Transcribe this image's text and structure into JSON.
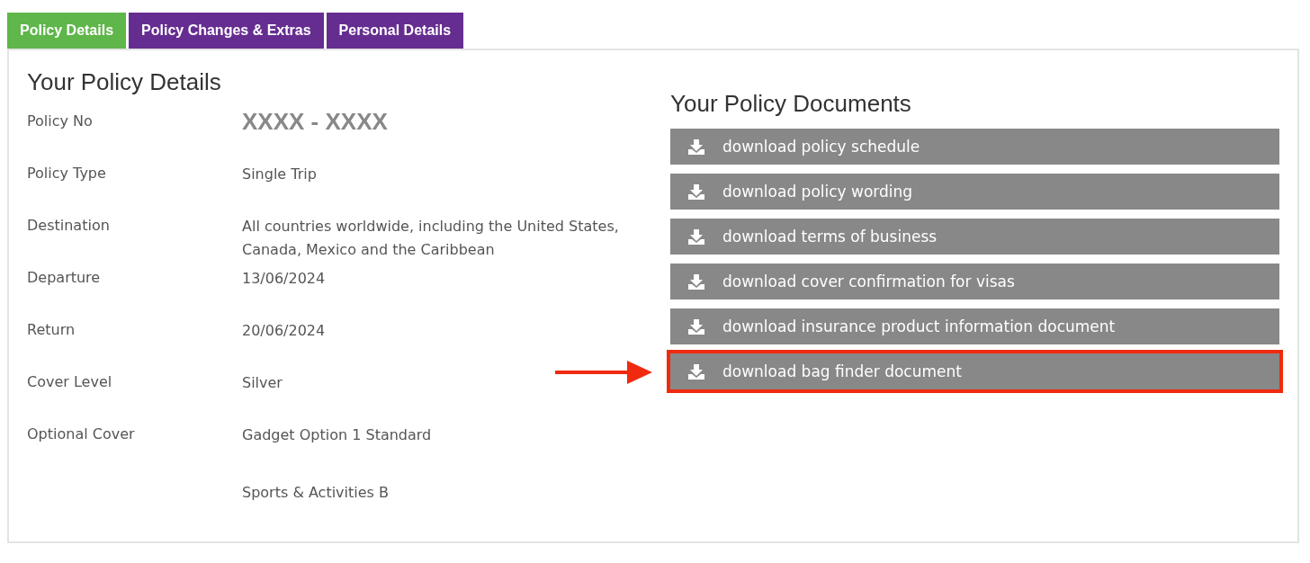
{
  "tabs": [
    {
      "label": "Policy Details",
      "selected": true
    },
    {
      "label": "Policy Changes & Extras",
      "selected": false
    },
    {
      "label": "Personal Details",
      "selected": false
    }
  ],
  "details": {
    "title": "Your Policy Details",
    "rows": [
      {
        "kind": "number",
        "label": "Policy No",
        "values": [
          "XXXX - XXXX"
        ]
      },
      {
        "kind": "text",
        "label": "Policy Type",
        "values": [
          "Single Trip"
        ]
      },
      {
        "kind": "text",
        "label": "Destination",
        "values": [
          "All countries worldwide, including the United States, Canada, Mexico and the Caribbean"
        ]
      },
      {
        "kind": "text",
        "label": "Departure",
        "values": [
          "13/06/2024"
        ]
      },
      {
        "kind": "text",
        "label": "Return",
        "values": [
          "20/06/2024"
        ]
      },
      {
        "kind": "text",
        "label": "Cover Level",
        "values": [
          "Silver"
        ]
      },
      {
        "kind": "text",
        "label": "Optional Cover",
        "values": [
          "Gadget Option 1 Standard",
          "Sports & Activities B"
        ]
      }
    ]
  },
  "documents": {
    "title": "Your Policy Documents",
    "items": [
      {
        "label": "download policy schedule",
        "highlighted": false
      },
      {
        "label": "download policy wording",
        "highlighted": false
      },
      {
        "label": "download terms of business",
        "highlighted": false
      },
      {
        "label": "download cover confirmation for visas",
        "highlighted": false
      },
      {
        "label": "download insurance product information document",
        "highlighted": false
      },
      {
        "label": "download bag finder document",
        "highlighted": true
      }
    ]
  }
}
